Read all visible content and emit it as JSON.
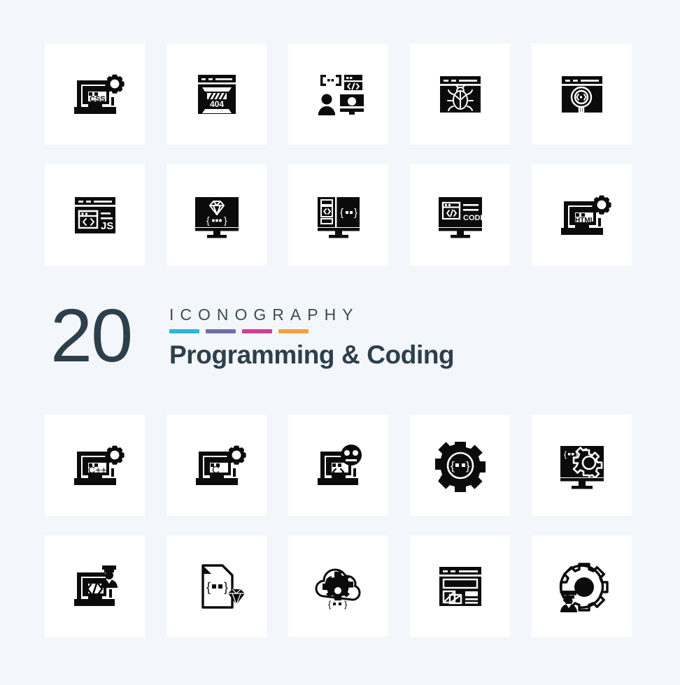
{
  "background_color": "#f3f6fa",
  "card_color": "#ffffff",
  "icon_color": "#0b0b0b",
  "banner": {
    "count": "20",
    "kicker": "ICONOGRAPHY",
    "title": "Programming & Coding",
    "text_color": "#2e3f4c",
    "bars": [
      {
        "name": "bar-cyan",
        "color": "#29b6dd"
      },
      {
        "name": "bar-purple",
        "color": "#6f6fa8"
      },
      {
        "name": "bar-magenta",
        "color": "#cf3f95"
      },
      {
        "name": "bar-orange",
        "color": "#f3a13f"
      },
      {
        "name": "bar-yellow",
        "color": "#f5c councils"
      }
    ]
  },
  "icons": [
    {
      "id": "css-laptop-settings",
      "label": "CSS",
      "caption": "laptop with CSS code and gear"
    },
    {
      "id": "browser-404-error",
      "label": "404",
      "caption": "browser window showing 404 error"
    },
    {
      "id": "developer-coding-monitor",
      "label": "",
      "caption": "developer with code brackets and monitor"
    },
    {
      "id": "browser-bug-debug",
      "label": "",
      "caption": "browser window with bug"
    },
    {
      "id": "browser-code-search",
      "label": "",
      "caption": "browser with magnifier over code"
    },
    {
      "id": "browser-js-code",
      "label": "JS",
      "caption": "browser window with JS code"
    },
    {
      "id": "monitor-diamond-code",
      "label": "",
      "caption": "monitor with diamond and code braces"
    },
    {
      "id": "monitor-split-code",
      "label": "",
      "caption": "monitor with split code panes"
    },
    {
      "id": "monitor-code-label",
      "label": "CODE",
      "caption": "monitor with CODE label"
    },
    {
      "id": "html-laptop-settings",
      "label": "HTML",
      "caption": "laptop with HTML code and gear"
    },
    {
      "id": "cpp-laptop-settings",
      "label": "C++",
      "caption": "laptop with C++ code and gear"
    },
    {
      "id": "c-laptop-settings",
      "label": "C",
      "caption": "laptop with C code and gear"
    },
    {
      "id": "laptop-code-emoji",
      "label": "",
      "caption": "laptop with code and neutral face"
    },
    {
      "id": "gear-code-settings",
      "label": "",
      "caption": "gear containing code braces"
    },
    {
      "id": "monitor-gear-code",
      "label": "",
      "caption": "monitor with gear and code braces"
    },
    {
      "id": "laptop-code-developer",
      "label": "",
      "caption": "laptop with code and graduate developer"
    },
    {
      "id": "file-code-diamond",
      "label": "",
      "caption": "document file with code braces and diamond"
    },
    {
      "id": "cloud-gear-code",
      "label": "",
      "caption": "cloud with gear and code braces"
    },
    {
      "id": "browser-wireframe-layout",
      "label": "",
      "caption": "browser window with wireframe layout"
    },
    {
      "id": "gear-developer-graduate",
      "label": "",
      "caption": "gear with graduate developer"
    }
  ]
}
